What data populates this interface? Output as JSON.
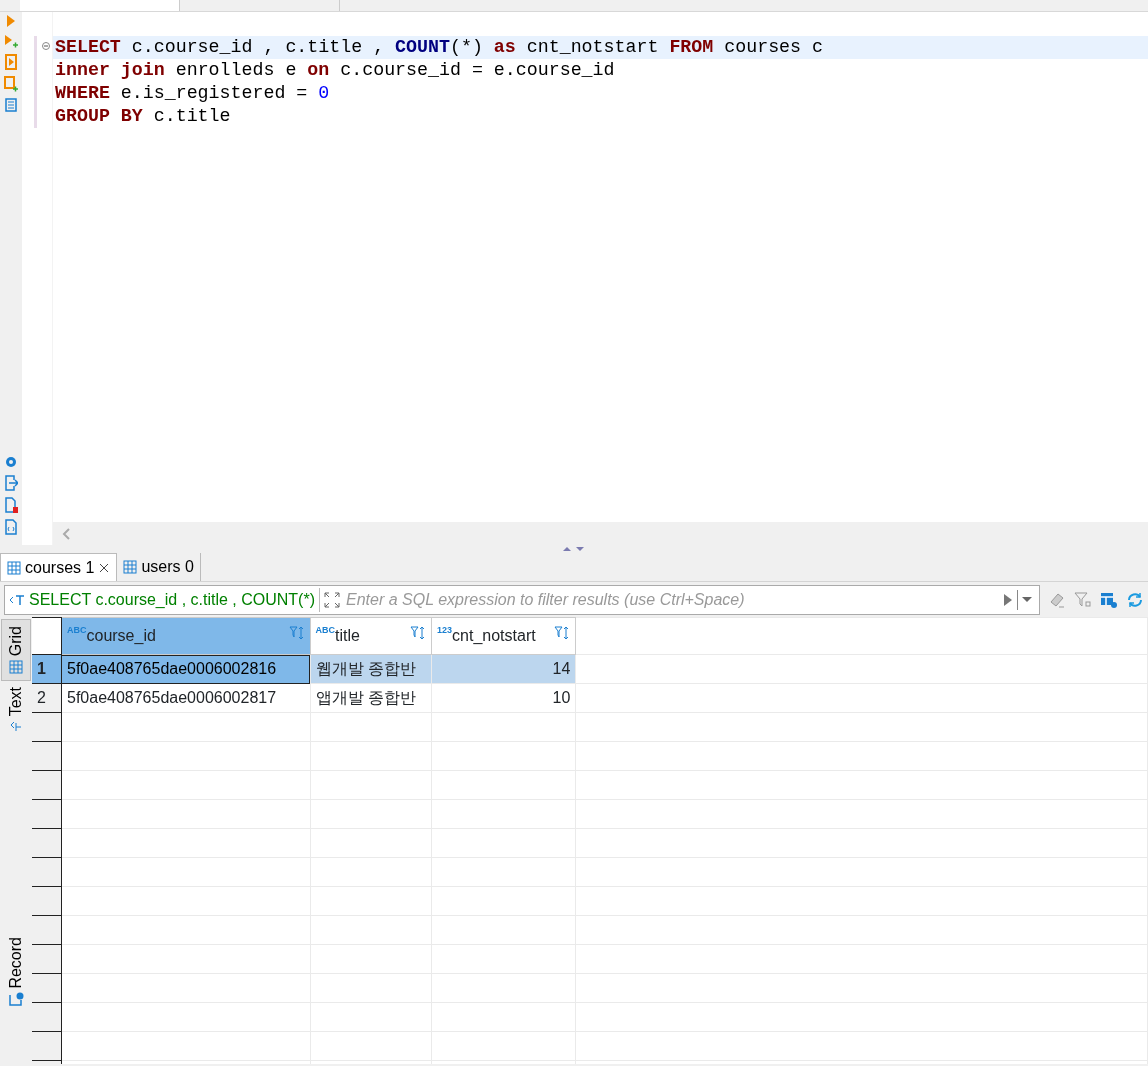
{
  "editor": {
    "lines": [
      {
        "current": true,
        "tokens": [
          {
            "kind": "keyword",
            "text": "SELECT"
          },
          {
            "kind": "plain",
            "text": " c.course_id , c.title , "
          },
          {
            "kind": "function",
            "text": "COUNT"
          },
          {
            "kind": "plain",
            "text": "(*) "
          },
          {
            "kind": "keyword",
            "text": "as"
          },
          {
            "kind": "plain",
            "text": " cnt_notstart "
          },
          {
            "kind": "keyword",
            "text": "FROM"
          },
          {
            "kind": "plain",
            "text": " courses c"
          }
        ]
      },
      {
        "current": false,
        "tokens": [
          {
            "kind": "keyword",
            "text": "inner join"
          },
          {
            "kind": "plain",
            "text": " enrolleds e "
          },
          {
            "kind": "keyword",
            "text": "on"
          },
          {
            "kind": "plain",
            "text": " c.course_id = e.course_id"
          }
        ]
      },
      {
        "current": false,
        "tokens": [
          {
            "kind": "keyword",
            "text": "WHERE"
          },
          {
            "kind": "plain",
            "text": " e.is_registered = "
          },
          {
            "kind": "number",
            "text": "0"
          }
        ]
      },
      {
        "current": false,
        "tokens": [
          {
            "kind": "keyword",
            "text": "GROUP BY"
          },
          {
            "kind": "plain",
            "text": " c.title"
          }
        ]
      }
    ]
  },
  "result_tabs": [
    {
      "label": "courses 1",
      "selected": true,
      "closable": true
    },
    {
      "label": "users 0",
      "selected": false,
      "closable": false
    }
  ],
  "filter": {
    "query": "SELECT c.course_id , c.title , COUNT(*)",
    "placeholder": "Enter a SQL expression to filter results (use Ctrl+Space)"
  },
  "view_tabs": [
    {
      "label": "Grid",
      "selected": true
    },
    {
      "label": "Text",
      "selected": false
    },
    {
      "label": "Record",
      "selected": false
    }
  ],
  "grid": {
    "columns": [
      {
        "name": "course_id",
        "type_label": "ABC",
        "selected": true
      },
      {
        "name": "title",
        "type_label": "ABC",
        "selected": false
      },
      {
        "name": "cnt_notstart",
        "type_label": "123",
        "selected": false
      }
    ],
    "rows": [
      {
        "number": "1",
        "selected": true,
        "cells": [
          {
            "text": "5f0ae408765dae0006002816",
            "focused": true
          },
          {
            "text": "웹개발 종합반",
            "focused": false
          },
          {
            "text": "14",
            "focused": false
          }
        ]
      },
      {
        "number": "2",
        "selected": false,
        "cells": [
          {
            "text": "5f0ae408765dae0006002817",
            "focused": false
          },
          {
            "text": "앱개발 종합반",
            "focused": false
          },
          {
            "text": "10",
            "focused": false
          }
        ]
      }
    ]
  }
}
